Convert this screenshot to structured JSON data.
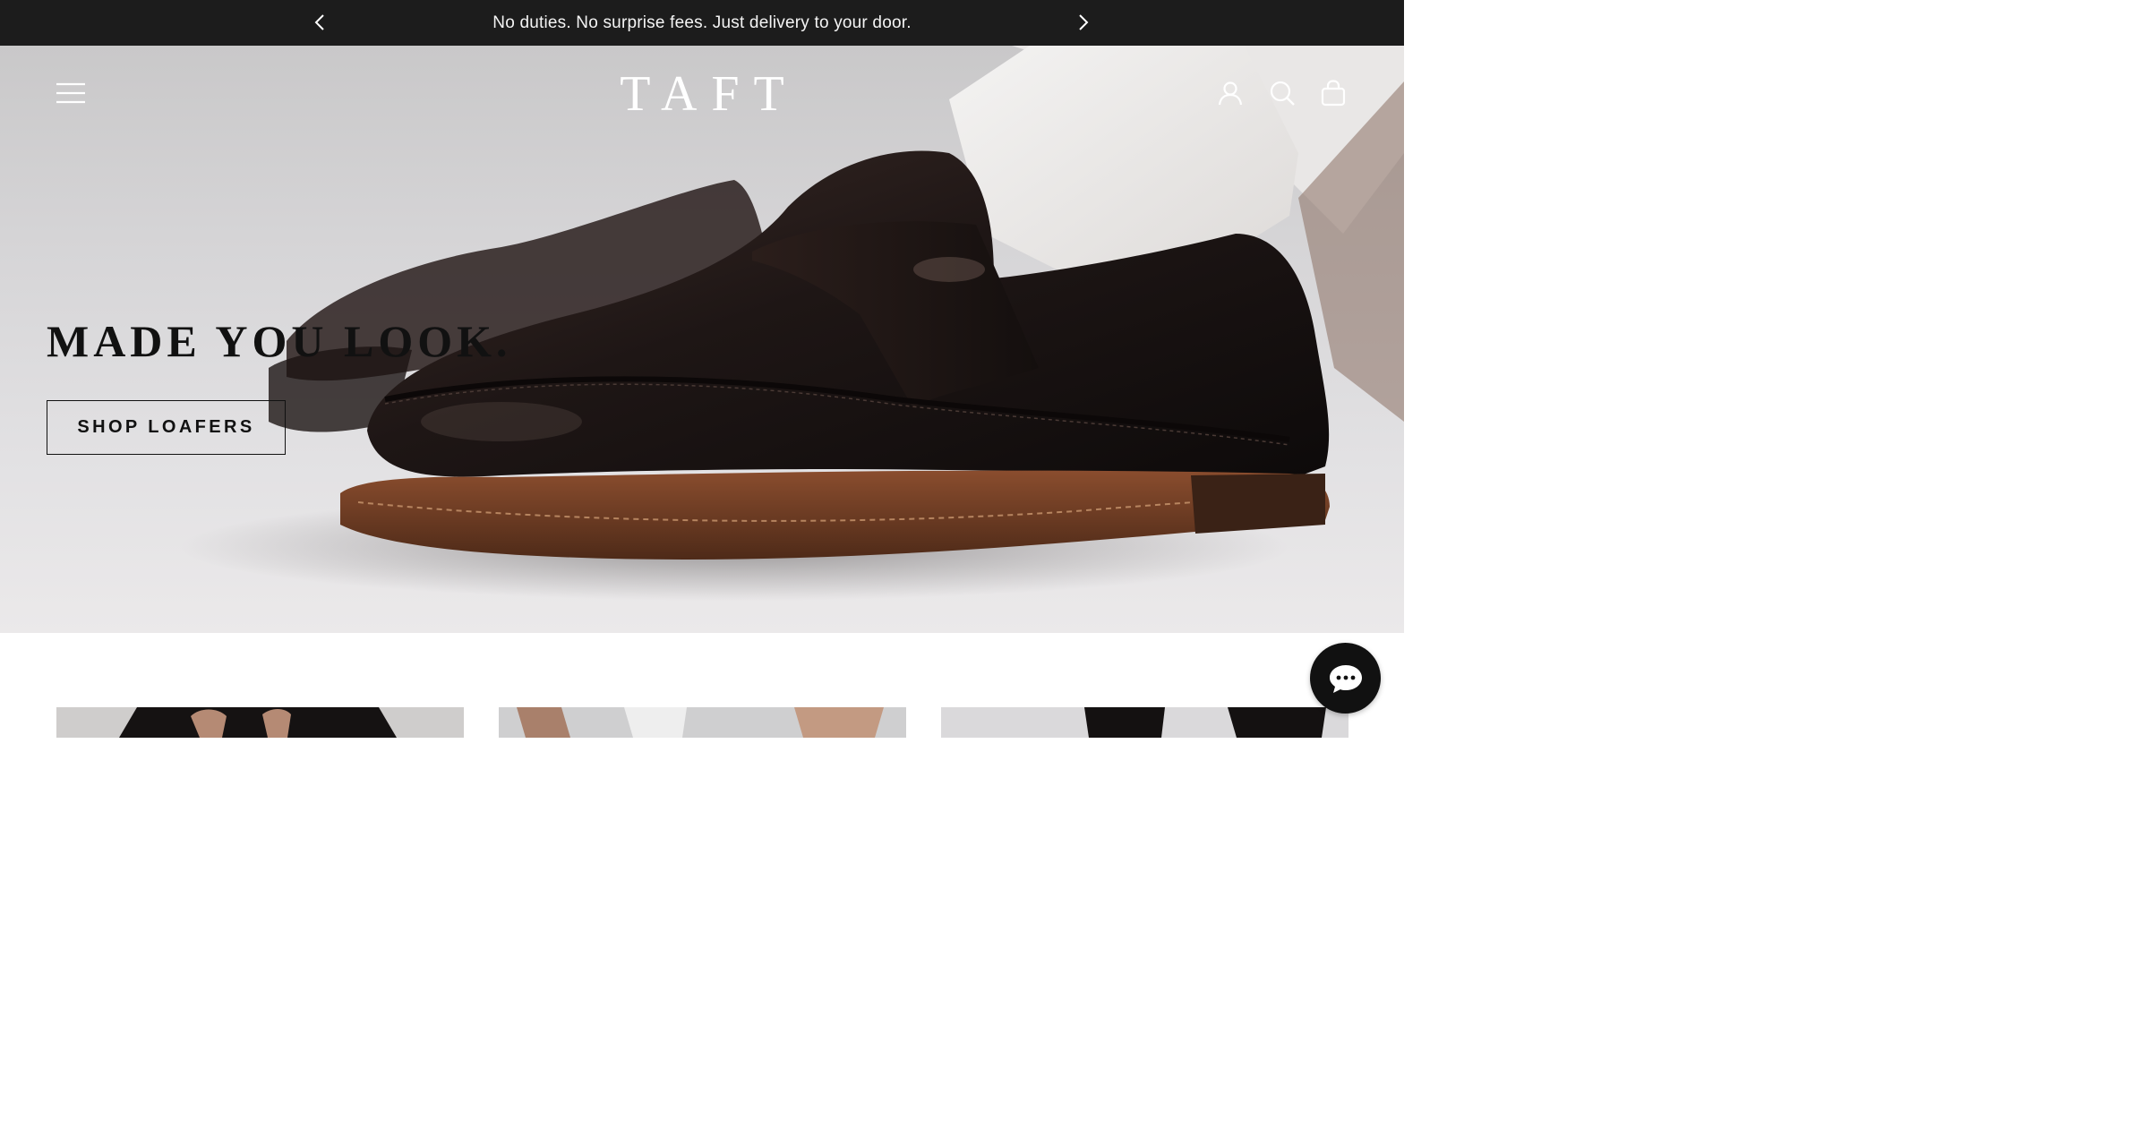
{
  "announcement": {
    "text": "No duties. No surprise fees. Just delivery to your door.",
    "prev_icon": "chevron-left-icon",
    "next_icon": "chevron-right-icon"
  },
  "header": {
    "logo": "TAFT",
    "menu_icon": "hamburger-menu-icon",
    "account_icon": "user-icon",
    "search_icon": "search-icon",
    "cart_icon": "shopping-bag-icon"
  },
  "hero": {
    "title": "MADE YOU LOOK.",
    "cta_label": "SHOP LOAFERS"
  },
  "chat": {
    "icon": "chat-bubble-icon"
  },
  "colors": {
    "announcement_bg": "#1c1c1c",
    "text_dark": "#111111",
    "white": "#ffffff",
    "leather_dark": "#1e1615",
    "sole_brown": "#6b3a22"
  }
}
